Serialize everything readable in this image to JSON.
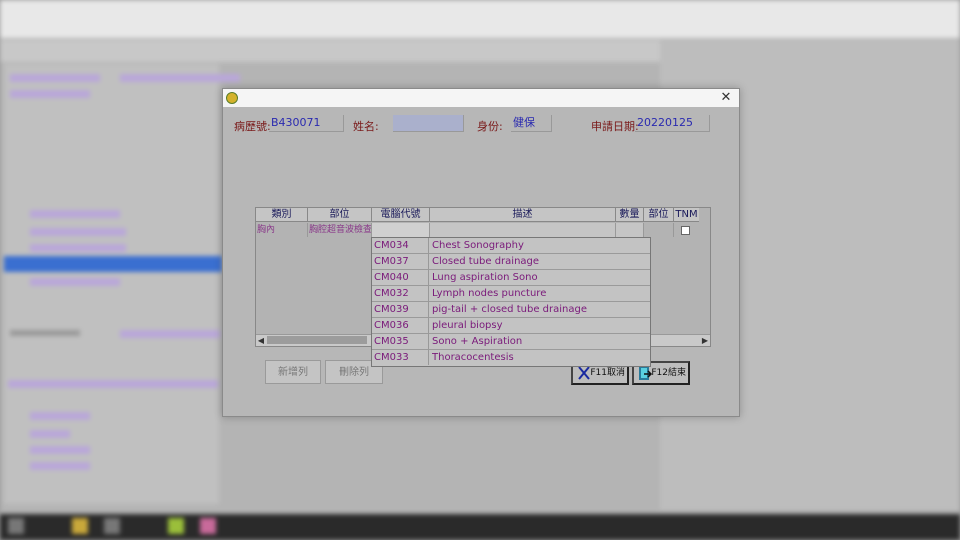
{
  "dialog": {
    "fields": {
      "chart_no_label": "病歷號:",
      "chart_no_value": "B430071",
      "name_label": "姓名:",
      "name_value": "",
      "identity_label": "身份:",
      "identity_value": "健保",
      "apply_date_label": "申請日期:",
      "apply_date_value": "20220125"
    },
    "grid": {
      "headers": [
        "類別",
        "部位",
        "電腦代號",
        "描述",
        "數量",
        "部位",
        "TNM"
      ],
      "row": {
        "category": "胸內",
        "site": "胸腔超音波檢查",
        "code": "",
        "desc": "",
        "qty": "",
        "site2": ""
      }
    },
    "dropdown": {
      "items": [
        {
          "code": "CM034",
          "desc": "Chest Sonography"
        },
        {
          "code": "CM037",
          "desc": "Closed tube drainage"
        },
        {
          "code": "CM040",
          "desc": "Lung aspiration Sono"
        },
        {
          "code": "CM032",
          "desc": "Lymph nodes puncture"
        },
        {
          "code": "CM039",
          "desc": "pig-tail + closed tube drainage"
        },
        {
          "code": "CM036",
          "desc": "pleural biopsy"
        },
        {
          "code": "CM035",
          "desc": "Sono + Aspiration"
        },
        {
          "code": "CM033",
          "desc": "Thoracocentesis"
        }
      ]
    },
    "buttons": {
      "add_row": "新增列",
      "delete_row": "刪除列",
      "cancel": "F11取消",
      "finish": "F12結束"
    },
    "close_glyph": "✕"
  },
  "colors": {
    "label": "#7a1a1a",
    "value": "#2a2ab0",
    "list_text": "#7a1a7a",
    "dialog_bg": "#b7b7b7"
  },
  "icons": [
    "app-icon",
    "close-icon",
    "cancel-x-icon",
    "finish-exit-icon"
  ]
}
